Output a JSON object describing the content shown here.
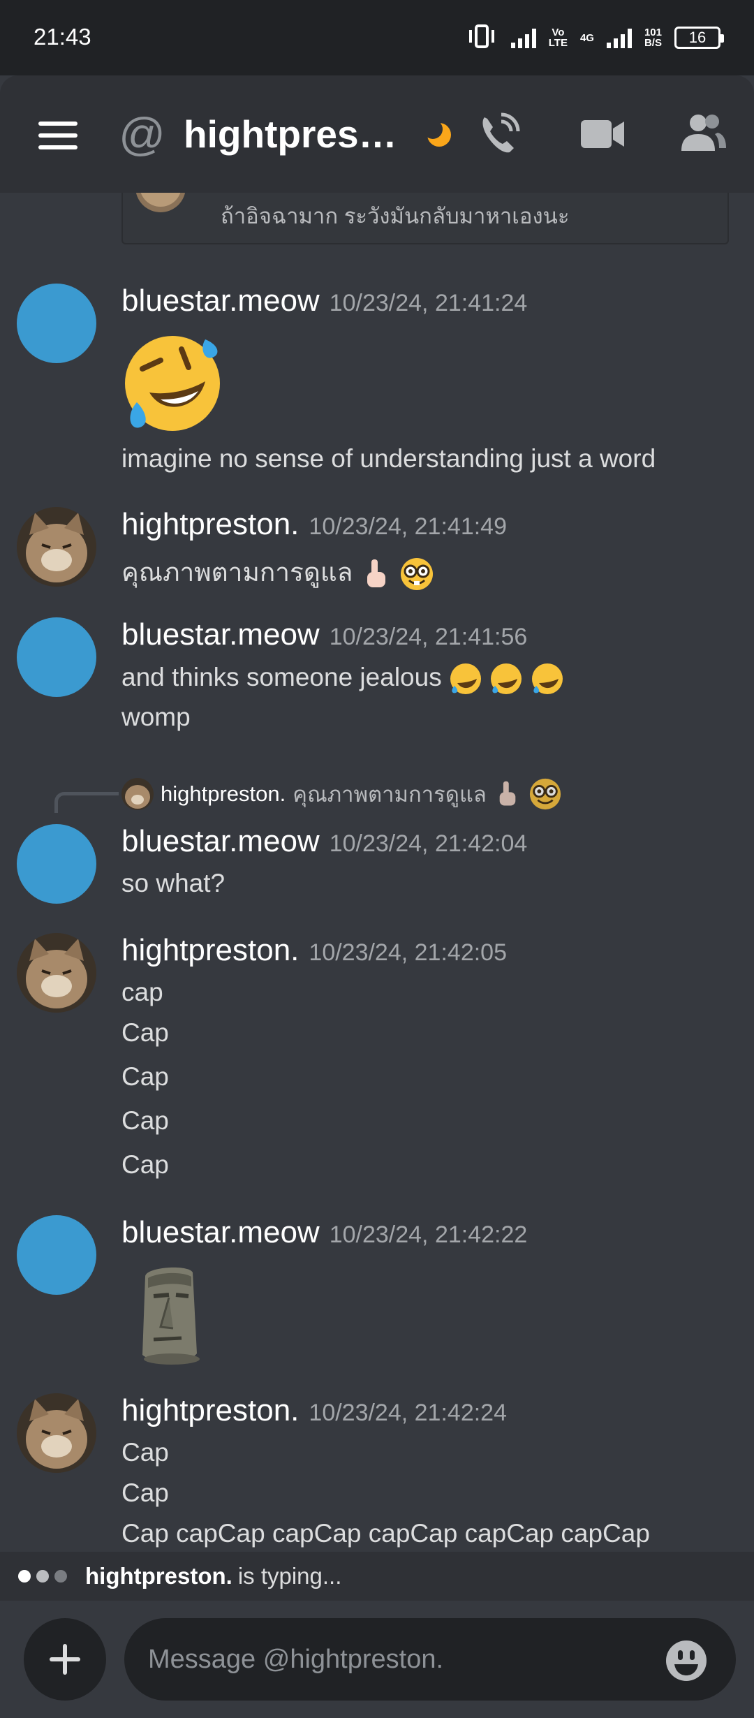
{
  "status_bar": {
    "time": "21:43",
    "vo_lte_top": "Vo",
    "vo_lte_bottom": "LTE",
    "net_gen": "4G",
    "speed_value": "101",
    "speed_unit": "B/S",
    "battery": "16"
  },
  "header": {
    "title": "hightpres…",
    "status": "idle (moon icon)"
  },
  "previous_quote": {
    "text": "ถ้าอิจฉามาก ระวังมันกลับมาหาเองนะ"
  },
  "messages": [
    {
      "author": "bluestar.meow",
      "timestamp": "10/23/24, 21:41:24",
      "big_emoji": "rolling-on-floor-laughing",
      "lines": [
        "imagine no sense of understanding just a word"
      ]
    },
    {
      "author": "hightpreston.",
      "timestamp": "10/23/24, 21:41:49",
      "lines": [
        "คุณภาพตามการดูแล"
      ],
      "trailing_emojis": [
        "pointing-up",
        "nerd-face"
      ]
    },
    {
      "author": "bluestar.meow",
      "timestamp": "10/23/24, 21:41:56",
      "lines": [
        "and thinks someone jealous ",
        "womp"
      ],
      "trailing_emojis": [
        "rofl",
        "rofl",
        "rofl"
      ]
    },
    {
      "author": "bluestar.meow",
      "timestamp": "10/23/24, 21:42:04",
      "lines": [
        "so what?"
      ],
      "reply": {
        "author": "hightpreston.",
        "text": "คุณภาพตามการดูแล"
      }
    },
    {
      "author": "hightpreston.",
      "timestamp": "10/23/24, 21:42:05",
      "lines": [
        "cap",
        "Cap",
        "Cap",
        "Cap",
        "Cap"
      ]
    },
    {
      "author": "bluestar.meow",
      "timestamp": "10/23/24, 21:42:22",
      "sticker": "moai"
    },
    {
      "author": "hightpreston.",
      "timestamp": "10/23/24, 21:42:24",
      "lines": [
        "Cap",
        "Cap",
        "Cap capCap capCap capCap capCap capCap"
      ]
    }
  ],
  "typing": {
    "user": "hightpreston.",
    "text": "is typing..."
  },
  "composer": {
    "placeholder": "Message @hightpreston."
  },
  "colors": {
    "background": "#36393f",
    "header": "#2f3136",
    "avatar_blue": "#3b9ad0",
    "idle_moon": "#faa61a"
  }
}
